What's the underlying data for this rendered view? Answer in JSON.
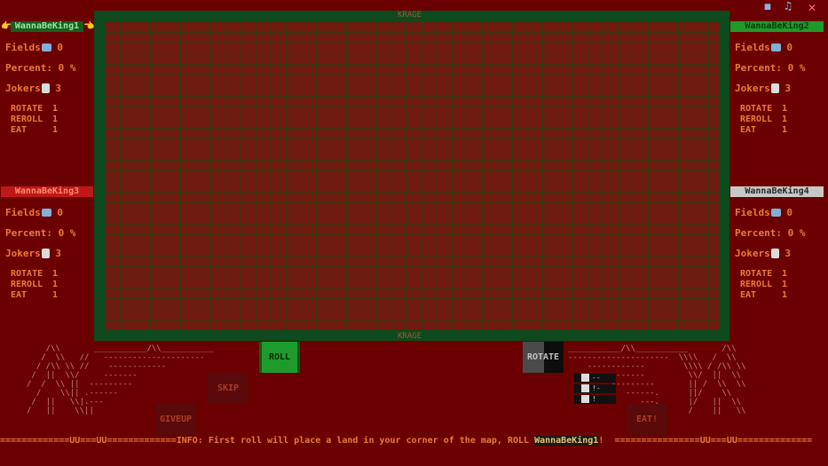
{
  "window": {
    "icons": [
      "speaker-icon",
      "music-icon",
      "close-icon"
    ]
  },
  "players": [
    {
      "name": "WannaBeKing1",
      "fields_label": "Fields",
      "fields": "0",
      "percent_label": "Percent:",
      "percent": "0 %",
      "jokers_label": "Jokers",
      "jokers": "3",
      "rotate_label": "ROTATE",
      "rotate": "1",
      "reroll_label": "REROLL",
      "reroll": "1",
      "eat_label": "EAT",
      "eat": "1",
      "pointer_left": "👉",
      "pointer_right": "👈",
      "color": "#16601f",
      "text_color": "#9de0a0"
    },
    {
      "name": "WannaBeKing2",
      "fields_label": "Fields",
      "fields": "0",
      "percent_label": "Percent:",
      "percent": "0 %",
      "jokers_label": "Jokers",
      "jokers": "3",
      "rotate_label": "ROTATE",
      "rotate": "1",
      "reroll_label": "REROLL",
      "reroll": "1",
      "eat_label": "EAT",
      "eat": "1",
      "color": "#1e9a2a",
      "text_color": "#0e3a10"
    },
    {
      "name": "WannaBeKing3",
      "fields_label": "Fields",
      "fields": "0",
      "percent_label": "Percent:",
      "percent": "0 %",
      "jokers_label": "Jokers",
      "jokers": "3",
      "rotate_label": "ROTATE",
      "rotate": "1",
      "reroll_label": "REROLL",
      "reroll": "1",
      "eat_label": "EAT",
      "eat": "1",
      "color": "#c01818",
      "text_color": "#ff8a70"
    },
    {
      "name": "WannaBeKing4",
      "fields_label": "Fields",
      "fields": "0",
      "percent_label": "Percent:",
      "percent": "0 %",
      "jokers_label": "Jokers",
      "jokers": "3",
      "rotate_label": "ROTATE",
      "rotate": "1",
      "reroll_label": "REROLL",
      "reroll": "1",
      "eat_label": "EAT",
      "eat": "1",
      "color": "#c8c8c8",
      "text_color": "#2a2a2a"
    }
  ],
  "board": {
    "top_label": "KRAGE",
    "bottom_label": "KRAGE"
  },
  "buttons": {
    "roll": "ROLL",
    "rotate": "ROTATE",
    "skip": "SKIP",
    "giveup": "GIVEUP",
    "eat": "EAT!"
  },
  "dice": [
    {
      "value": "--"
    },
    {
      "value": "!-"
    },
    {
      "value": "!"
    }
  ],
  "info": {
    "prefix": "=============UU===UU=============",
    "label": "INFO",
    "message": ": First roll will place a land in your corner of the map, ROLL ",
    "player": "WannaBeKing1",
    "suffix": "!  ================UU===UU=============="
  }
}
